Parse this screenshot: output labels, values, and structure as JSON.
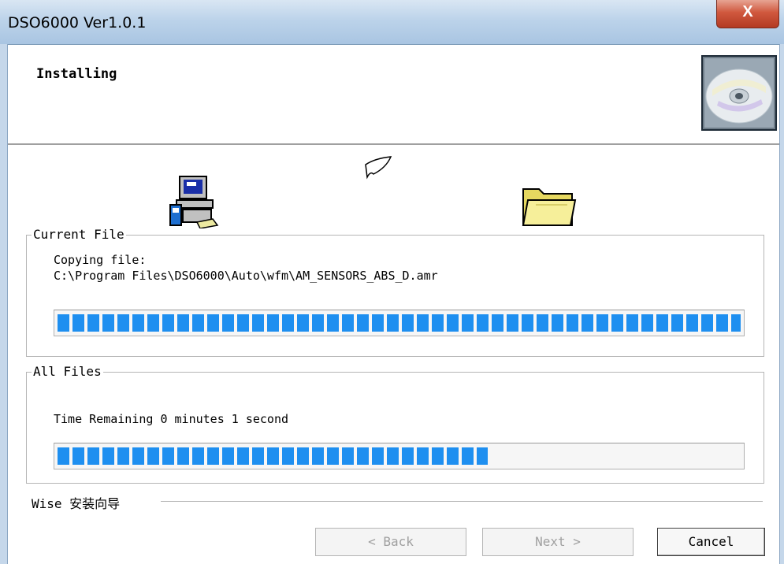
{
  "window": {
    "title": "DSO6000 Ver1.0.1",
    "close_label": "X"
  },
  "header": {
    "title": "Installing"
  },
  "icons": {
    "cd": "cd-disc-icon",
    "computer": "computer-icon",
    "paper": "flying-paper-icon",
    "folder": "folder-icon"
  },
  "current_file": {
    "legend": "Current File",
    "line1": "Copying file:",
    "path": "C:\\Program Files\\DSO6000\\Auto\\wfm\\AM_SENSORS_ABS_D.amr",
    "progress": 1.0
  },
  "all_files": {
    "legend": "All Files",
    "time_remaining": "Time Remaining 0 minutes 1 second",
    "progress": 0.63
  },
  "footer": {
    "brand": "Wise 安装向导"
  },
  "buttons": {
    "back": "< Back",
    "next": "Next >",
    "cancel": "Cancel"
  },
  "colors": {
    "progress_fill": "#1e8ff0",
    "titlebar": "#bcd3ea",
    "close": "#d0583e"
  }
}
